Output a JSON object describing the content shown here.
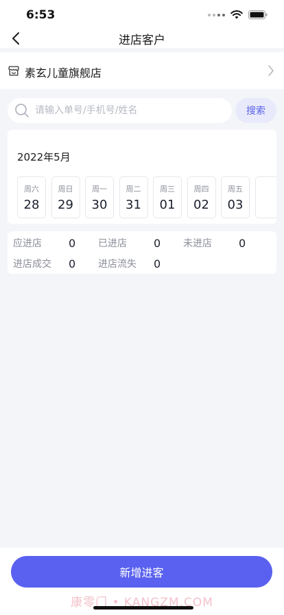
{
  "status_bar": {
    "time": "6:53"
  },
  "nav": {
    "title": "进店客户"
  },
  "store": {
    "name": "素玄儿童旗舰店"
  },
  "search": {
    "placeholder": "请输入单号/手机号/姓名",
    "button_label": "搜索"
  },
  "calendar": {
    "month_label": "2022年5月",
    "days": [
      {
        "week": "周六",
        "date": "28"
      },
      {
        "week": "周日",
        "date": "29"
      },
      {
        "week": "周一",
        "date": "30"
      },
      {
        "week": "周二",
        "date": "31"
      },
      {
        "week": "周三",
        "date": "01"
      },
      {
        "week": "周四",
        "date": "02"
      },
      {
        "week": "周五",
        "date": "03"
      }
    ]
  },
  "stats": [
    {
      "label": "应进店",
      "value": "0"
    },
    {
      "label": "已进店",
      "value": "0"
    },
    {
      "label": "未进店",
      "value": "0"
    },
    {
      "label": "进店成交",
      "value": "0"
    },
    {
      "label": "进店流失",
      "value": "0"
    }
  ],
  "footer": {
    "add_button_label": "新增进客",
    "watermark": "康零门 • KANGZM.COM"
  },
  "colors": {
    "accent": "#5a61f0",
    "search_button_bg": "#e8eafb",
    "page_bg": "#f4f5f9"
  }
}
